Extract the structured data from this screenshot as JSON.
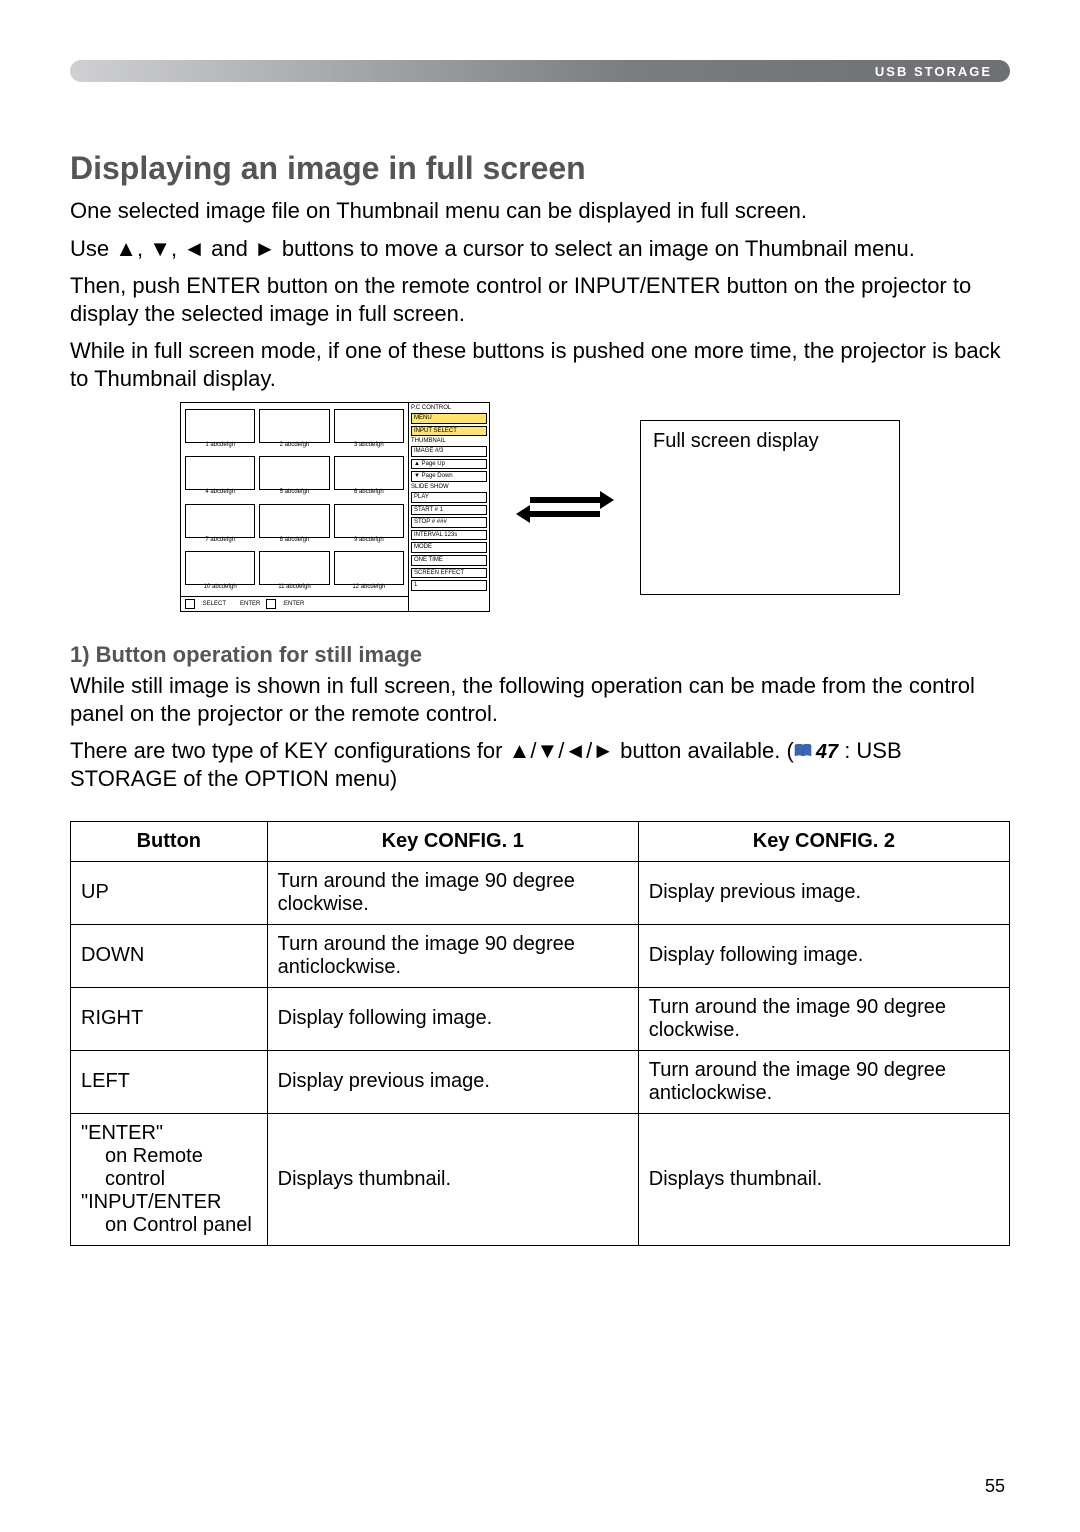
{
  "header": {
    "section_label": "USB STORAGE"
  },
  "section": {
    "title": "Displaying an image in full screen",
    "p1": "One selected image file on Thumbnail menu can be displayed in full screen.",
    "p2_a": "Use ",
    "p2_b": " buttons to move a cursor to select an image on Thumbnail menu.",
    "p3": "Then, push ENTER button on the remote control or INPUT/ENTER button on the projector to display the selected image in full screen.",
    "p4": "While in full screen mode, if one of these buttons is pushed one more time, the projector is back to Thumbnail display."
  },
  "arrows_glyphs": {
    "up": "▲",
    "down": "▼",
    "left": "◄",
    "right": "►",
    "combo": "▲/▼/◄/►",
    "list": "▲, ▼, ◄ and ►"
  },
  "thumbnail_menu": {
    "captions": [
      "1 abcdefgh",
      "2 abcdefgh",
      "3 abcdefgh",
      "4 abcdefgh",
      "5 abcdefgh",
      "6 abcdefgh",
      "7 abcdefgh",
      "8 abcdefgh",
      "9 abcdefgh",
      "10 abcdefgh",
      "11 abcdefgh",
      "12 abcdefgh"
    ],
    "footer": {
      "select": ":SELECT",
      "enter_l": "ENTER",
      "enter_r": ":ENTER"
    },
    "side": {
      "pc_control": "P.C CONTROL",
      "menu": "MENU",
      "input_select": "INPUT SELECT",
      "thumbnail": "THUMBNAIL",
      "image": "IMAGE     #/3",
      "page_up": "▲ Page Up",
      "page_down": "▼ Page Down",
      "slide_show": "SLIDE SHOW",
      "play": "PLAY",
      "start": "START   # 1",
      "stop": "STOP    # ###",
      "interval": "INTERVAL 123s",
      "mode": "MODE",
      "one_time": "ONE TIME",
      "screen_effect": "SCREEN EFFECT",
      "screen_effect_val": "1"
    }
  },
  "full_screen_box": "Full screen display",
  "subsection": {
    "title": "1) Button operation for still image",
    "p1": "While still image is shown in full screen, the following operation can be made from the control panel on the projector or the remote control.",
    "p2_a": "There are two type of KEY configurations for ",
    "p2_b": " button available. (",
    "ref_no": "47",
    "p2_c": " : USB STORAGE of the OPTION menu)"
  },
  "table": {
    "headers": {
      "c1": "Button",
      "c2": "Key CONFIG. 1",
      "c3": "Key CONFIG. 2"
    },
    "rows": [
      {
        "button": "UP",
        "c1": "Turn around the image 90 degree clockwise.",
        "c2": "Display previous image."
      },
      {
        "button": "DOWN",
        "c1": "Turn around the image 90 degree anticlockwise.",
        "c2": "Display following image."
      },
      {
        "button": "RIGHT",
        "c1": "Display following image.",
        "c2": "Turn around the image 90 degree clockwise."
      },
      {
        "button": "LEFT",
        "c1": "Display previous image.",
        "c2": "Turn around the image 90 degree anticlockwise."
      }
    ],
    "enter_row": {
      "l1a": "\"ENTER\"",
      "l2a": "on Remote control",
      "l1b": "\"INPUT/ENTER",
      "l2b": "on Control panel",
      "c1": "Displays thumbnail.",
      "c2": "Displays thumbnail."
    }
  },
  "page_no": "55"
}
